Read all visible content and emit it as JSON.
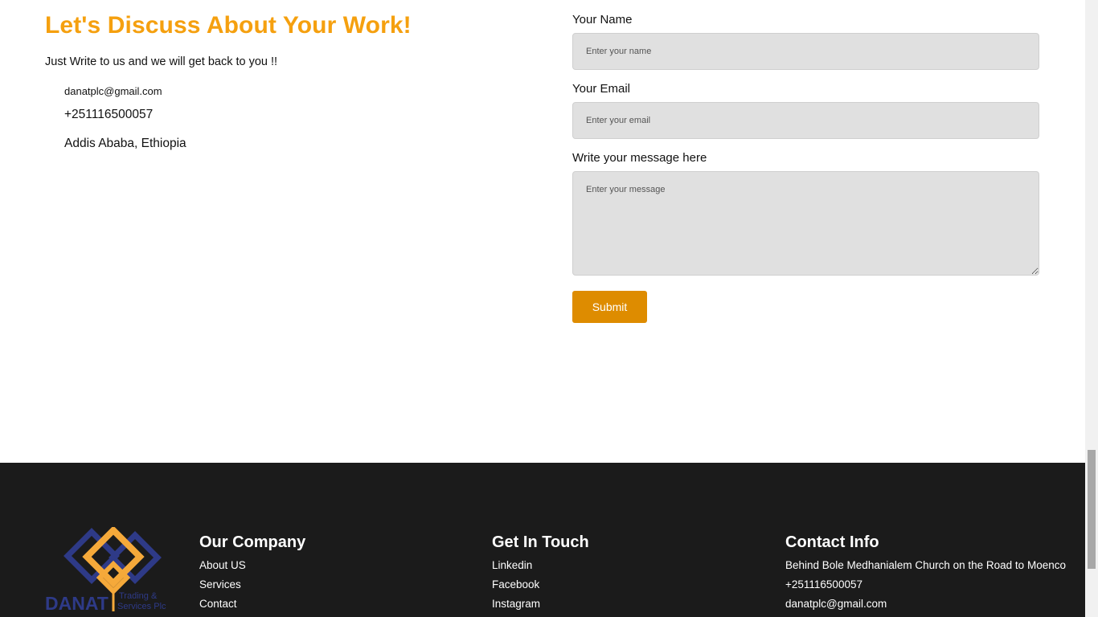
{
  "contact_section": {
    "heading": "Let's Discuss About Your Work!",
    "subtext": "Just Write to us and we will get back to you !!",
    "email": "danatplc@gmail.com",
    "phone": "+251116500057",
    "address": "Addis Ababa, Ethiopia"
  },
  "form": {
    "name_label": "Your Name",
    "name_placeholder": "Enter your name",
    "email_label": "Your Email",
    "email_placeholder": "Enter your email",
    "message_label": "Write your message here",
    "message_placeholder": "Enter your message",
    "submit_label": "Submit"
  },
  "footer": {
    "logo": {
      "brand": "DANAT",
      "tagline": "Trading & Services Plc"
    },
    "our_company": {
      "title": "Our Company",
      "items": [
        "About US",
        "Services",
        "Contact"
      ]
    },
    "get_in_touch": {
      "title": "Get In Touch",
      "items": [
        "Linkedin",
        "Facebook",
        "Instagram"
      ]
    },
    "contact_info": {
      "title": "Contact Info",
      "items": [
        "Behind Bole Medhanialem Church on the Road to Moenco",
        "+251116500057",
        "danatplc@gmail.com"
      ]
    }
  },
  "colors": {
    "accent_orange": "#f5a00f",
    "button_orange": "#de8c00",
    "footer_bg": "#1b1b1b",
    "logo_blue": "#2e3a87"
  }
}
